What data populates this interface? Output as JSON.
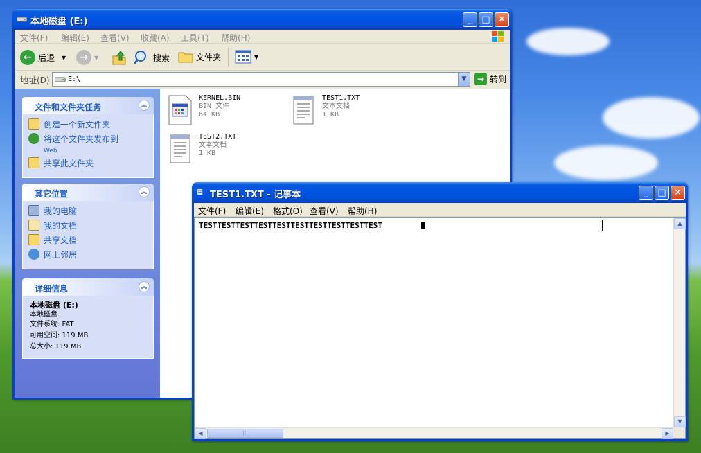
{
  "explorer": {
    "title": "本地磁盘 (E:)",
    "menu": [
      "文件(F)",
      "编辑(E)",
      "查看(V)",
      "收藏(A)",
      "工具(T)",
      "帮助(H)"
    ],
    "toolbar": {
      "back": "后退",
      "search": "搜索",
      "folders": "文件夹"
    },
    "address": {
      "label": "地址(D)",
      "value": "E:\\",
      "go": "转到"
    },
    "tasks_panel": {
      "title": "文件和文件夹任务",
      "items": [
        {
          "label": "创建一个新文件夹",
          "icon": "new-folder-icon"
        },
        {
          "label": "将这个文件夹发布到",
          "sub": "Web",
          "icon": "publish-web-icon"
        },
        {
          "label": "共享此文件夹",
          "icon": "share-folder-icon"
        }
      ]
    },
    "places_panel": {
      "title": "其它位置",
      "items": [
        {
          "label": "我的电脑",
          "icon": "my-computer-icon"
        },
        {
          "label": "我的文档",
          "icon": "my-documents-icon"
        },
        {
          "label": "共享文档",
          "icon": "shared-documents-icon"
        },
        {
          "label": "网上邻居",
          "icon": "network-places-icon"
        }
      ]
    },
    "details_panel": {
      "title": "详细信息",
      "name": "本地磁盘 (E:)",
      "type": "本地磁盘",
      "filesystem": "文件系统: FAT",
      "free": "可用空间: 119 MB",
      "total": "总大小: 119 MB"
    },
    "files": [
      {
        "name": "KERNEL.BIN",
        "type": "BIN 文件",
        "size": "64 KB",
        "icon": "bin-file-icon"
      },
      {
        "name": "TEST1.TXT",
        "type": "文本文档",
        "size": "1 KB",
        "icon": "text-file-icon"
      },
      {
        "name": "TEST2.TXT",
        "type": "文本文档",
        "size": "1 KB",
        "icon": "text-file-icon"
      }
    ]
  },
  "notepad": {
    "title": "TEST1.TXT - 记事本",
    "menu": [
      "文件(F)",
      "编辑(E)",
      "格式(O)",
      "查看(V)",
      "帮助(H)"
    ],
    "content": "TESTTESTTESTTESTTESTTESTTESTTESTTESTTEST"
  },
  "colors": {
    "title_blue": "#0054e3",
    "task_link": "#215dc6",
    "close_red": "#d1421b"
  }
}
